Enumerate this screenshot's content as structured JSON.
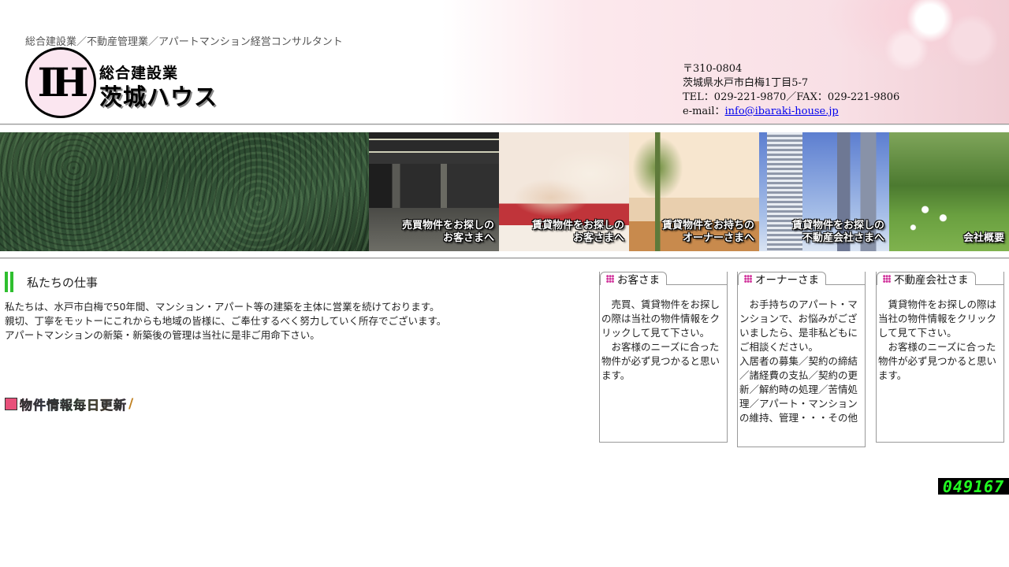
{
  "header": {
    "tagline": "総合建設業／不動産管理業／アパートマンション経営コンサルタント",
    "logo_mark": "IH",
    "logo_line1": "総合建設業",
    "logo_line2": "茨城ハウス",
    "address": {
      "postal": "〒310-0804",
      "street": "茨城県水戸市白梅1丁目5-7",
      "phone_fax": "TEL：029-221-9870／FAX：029-221-9806",
      "email_label": "e-mail：",
      "email": "info@ibaraki-house.jp"
    }
  },
  "nav": {
    "tiles": [
      {
        "label": "売買物件をお探しの\nお客さまへ"
      },
      {
        "label": "賃貸物件をお探しの\nお客さまへ"
      },
      {
        "label": "賃貸物件をお持ちの\nオーナーさまへ"
      },
      {
        "label": "賃貸物件をお探しの\n不動産会社さまへ"
      },
      {
        "label": "会社概要"
      }
    ]
  },
  "main": {
    "section_title": "私たちの仕事",
    "intro": [
      "私たちは、水戸市白梅で50年間、マンション・アパート等の建築を主体に営業を続けております。",
      "親切、丁寧をモットーにこれからも地域の皆様に、ご奉仕するべく努力していく所存でございます。",
      "アパートマンションの新築・新築後の管理は当社に是非ご用命下さい。"
    ],
    "update_badge": "物件情報毎日更新"
  },
  "boxes": [
    {
      "title": "お客さま",
      "text": "　売買、賃貸物件をお探しの際は当社の物件情報をクリックして見て下さい。\n　お客様のニーズに合った物件が必ず見つかると思います。"
    },
    {
      "title": "オーナーさま",
      "text": "　お手持ちのアパート・マンションで、お悩みがございましたら、是非私どもにご相談ください。\n入居者の募集／契約の締結／諸経費の支払／契約の更新／解約時の処理／苦情処理／アパート・マンションの維持、管理・・・その他"
    },
    {
      "title": "不動産会社さま",
      "text": "　賃貸物件をお探しの際は当社の物件情報をクリックして見て下さい。\n　お客様のニーズに合った物件が必ず見つかると思います。"
    }
  ],
  "counter": "049167",
  "colors": {
    "accent_bar": "#2fbf2f",
    "link": "#0000ee",
    "counter_digits": "#22ff22"
  }
}
